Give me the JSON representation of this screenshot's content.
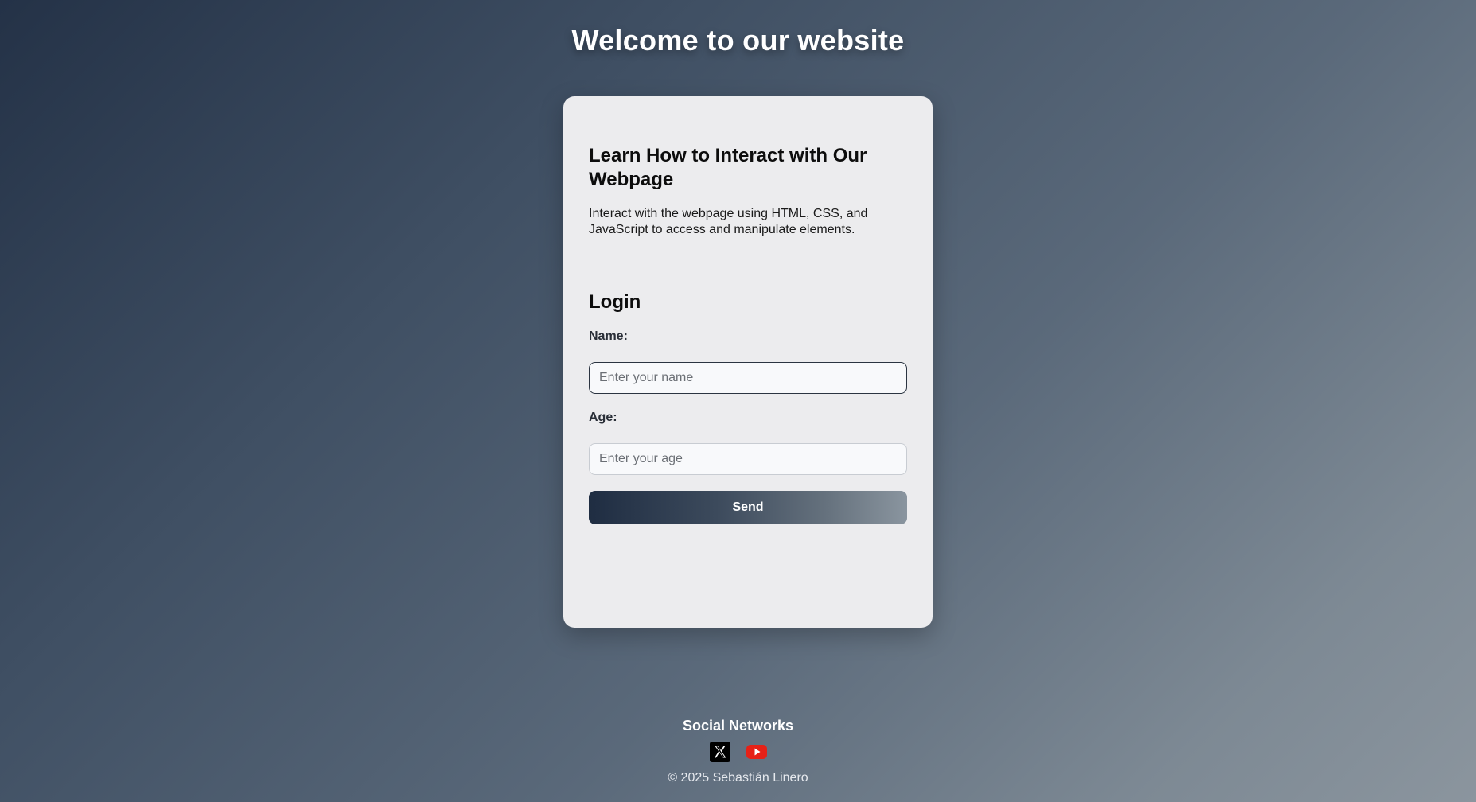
{
  "header": {
    "title": "Welcome to our website"
  },
  "info": {
    "heading": "Learn How to Interact with Our Webpage",
    "text": "Interact with the webpage using HTML, CSS, and JavaScript to access and manipulate elements."
  },
  "login": {
    "heading": "Login",
    "name_label": "Name:",
    "name_placeholder": "Enter your name",
    "name_value": "",
    "age_label": "Age:",
    "age_placeholder": "Enter your age",
    "age_value": "",
    "send_label": "Send"
  },
  "footer": {
    "title": "Social Networks",
    "links": [
      {
        "icon": "x-icon"
      },
      {
        "icon": "youtube-icon"
      }
    ],
    "copyright": "© 2025 Sebastián Linero"
  },
  "colors": {
    "card_background": "#ececee",
    "button_gradient_start": "#1f2d42",
    "button_gradient_end": "#8a959f",
    "youtube_red": "#e62117"
  }
}
